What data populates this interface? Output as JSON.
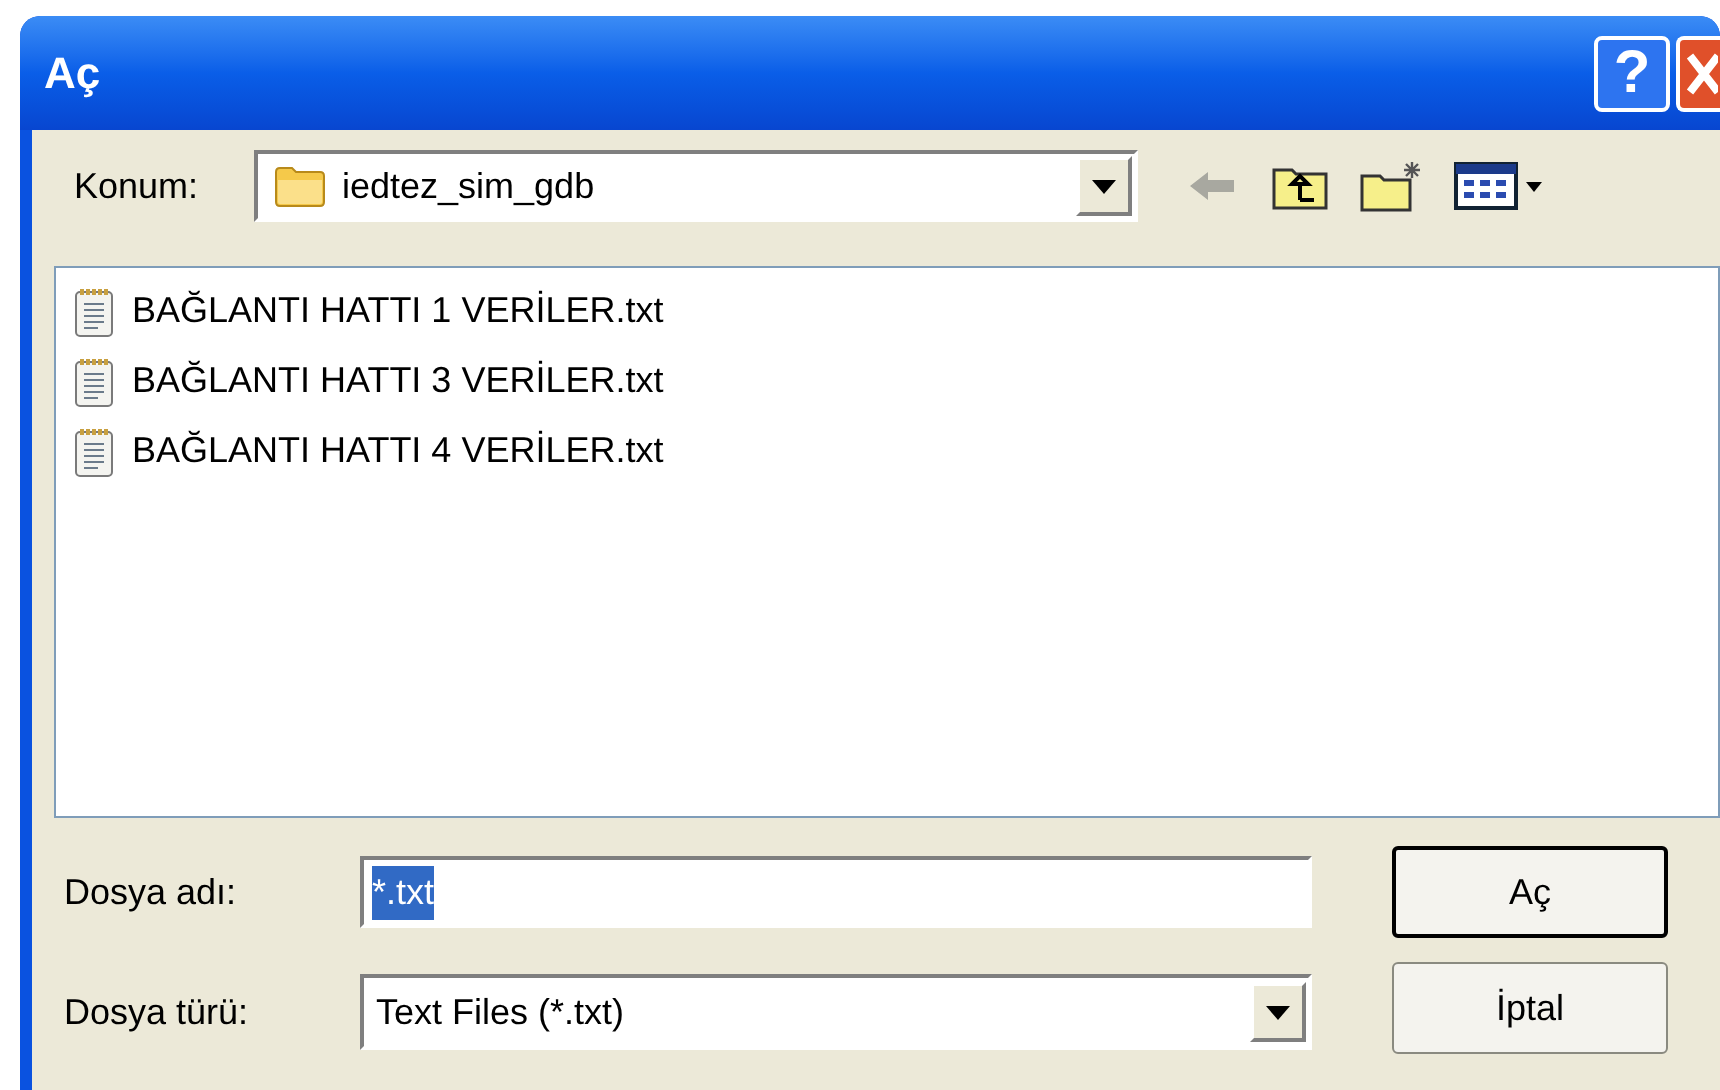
{
  "window": {
    "title": "Aç",
    "title_buttons": [
      {
        "label": "?",
        "kind": "help"
      },
      {
        "kind": "close"
      }
    ]
  },
  "location": {
    "label": "Konum:",
    "value": "iedtez_sim_gdb"
  },
  "files": [
    {
      "name": "BAĞLANTI HATTI 1 VERİLER.txt"
    },
    {
      "name": "BAĞLANTI HATTI 3 VERİLER.txt"
    },
    {
      "name": "BAĞLANTI HATTI 4 VERİLER.txt"
    }
  ],
  "file_name": {
    "label": "Dosya adı:",
    "value": "*.txt",
    "text_selected": true
  },
  "file_type": {
    "label": "Dosya türü:",
    "value": "Text Files (*.txt)"
  },
  "buttons": [
    {
      "label": "Aç",
      "default": true
    },
    {
      "label": "İptal",
      "default": false
    }
  ]
}
